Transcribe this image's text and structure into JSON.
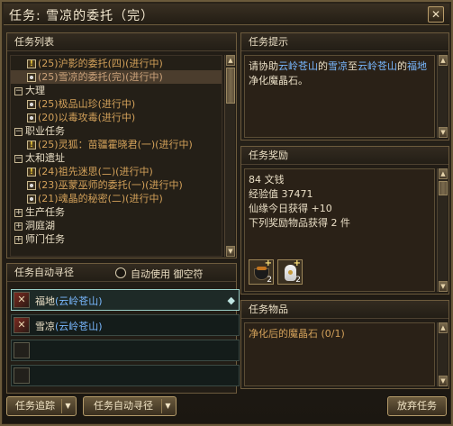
{
  "window": {
    "title": "任务: 雪凉的委托（完）",
    "close": "✕"
  },
  "quest_list": {
    "header": "任务列表",
    "rows": [
      {
        "type": "quest",
        "status": "progress",
        "text": "(25)沪影的委托(四)(进行中)"
      },
      {
        "type": "quest",
        "status": "done",
        "text": "(25)雪凉的委托(完)(进行中)",
        "selected": true
      },
      {
        "type": "category",
        "expander": "⊟",
        "text": "大理"
      },
      {
        "type": "quest",
        "text": "(25)极品山珍(进行中)"
      },
      {
        "type": "quest",
        "text": "(20)以毒攻毒(进行中)"
      },
      {
        "type": "category",
        "expander": "⊟",
        "text": "职业任务"
      },
      {
        "type": "quest",
        "status": "progress",
        "text": "(25)灵狐：苗疆霍晓君(一)(进行中)"
      },
      {
        "type": "category",
        "expander": "⊟",
        "text": "太和遗址"
      },
      {
        "type": "quest",
        "status": "progress",
        "text": "(24)祖先迷思(二)(进行中)"
      },
      {
        "type": "quest",
        "text": "(23)巫蒙巫师的委托(一)(进行中)"
      },
      {
        "type": "quest",
        "text": "(21)魂晶的秘密(二)(进行中)"
      },
      {
        "type": "category",
        "expander": "⊞",
        "text": "生产任务"
      },
      {
        "type": "category",
        "expander": "⊞",
        "text": "洞庭湖"
      },
      {
        "type": "category",
        "expander": "⊞",
        "text": "师门任务"
      }
    ]
  },
  "auto_path": {
    "header": "任务自动寻径",
    "checkbox_label": "自动使用 御空符",
    "rows": [
      {
        "label": "福地",
        "location": "(云岭苍山)",
        "active": true
      },
      {
        "label": "雪凉",
        "location": "(云岭苍山)",
        "active": false
      },
      {
        "label": "",
        "location": "",
        "active": false
      },
      {
        "label": "",
        "location": "",
        "active": false
      }
    ]
  },
  "hint": {
    "header": "任务提示",
    "parts": [
      {
        "t": "请协助",
        "c": "n"
      },
      {
        "t": "云岭苍山",
        "c": "h"
      },
      {
        "t": "的",
        "c": "n"
      },
      {
        "t": "雪凉",
        "c": "h"
      },
      {
        "t": "至",
        "c": "n"
      },
      {
        "t": "云岭苍山",
        "c": "h"
      },
      {
        "t": "的",
        "c": "n"
      },
      {
        "t": "福地",
        "c": "h"
      },
      {
        "t": "净化魔晶石。",
        "c": "n"
      }
    ]
  },
  "reward": {
    "header": "任务奖励",
    "lines": [
      "84 文钱",
      "经验值 37471",
      "仙缘今日获得 +10",
      "下列奖励物品获得 2 件"
    ],
    "items": [
      {
        "icon": "pot-icon",
        "count": "2"
      },
      {
        "icon": "vase-icon",
        "count": "2"
      }
    ]
  },
  "items": {
    "header": "任务物品",
    "lines": [
      "净化后的魔晶石 (0/1)"
    ]
  },
  "buttons": {
    "track": "任务追踪",
    "auto": "任务自动寻径",
    "abandon": "放弃任务"
  },
  "colors": {
    "quest": "#d3a15a",
    "link": "#79b8ff",
    "border": "#6d5b3d"
  }
}
